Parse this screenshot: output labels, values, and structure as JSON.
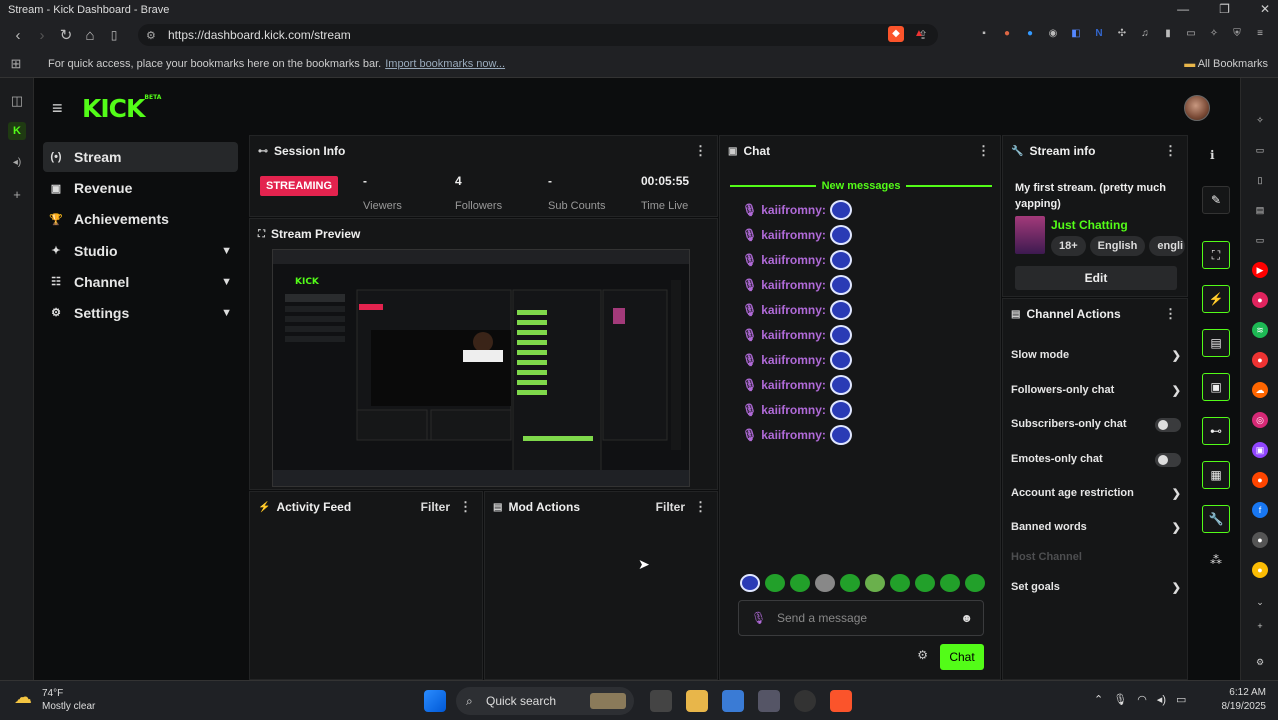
{
  "window": {
    "title": "Stream - Kick Dashboard - Brave",
    "controls": [
      "—",
      "❐",
      "✕"
    ]
  },
  "browser": {
    "url": "https://dashboard.kick.com/stream",
    "bookmarks_prompt": "For quick access, place your bookmarks here on the bookmarks bar.",
    "import_link": "Import bookmarks now...",
    "all_bookmarks": "All Bookmarks"
  },
  "brand": {
    "logo": "KICK",
    "beta": "BETA",
    "accent": "#53fc18"
  },
  "sidebar": {
    "items": [
      {
        "label": "Stream",
        "icon": "(•)"
      },
      {
        "label": "Revenue",
        "icon": "▣"
      },
      {
        "label": "Achievements",
        "icon": "🏆"
      },
      {
        "label": "Studio",
        "icon": "✦"
      },
      {
        "label": "Channel",
        "icon": "☷"
      },
      {
        "label": "Settings",
        "icon": "⚙"
      }
    ]
  },
  "session": {
    "title": "Session Info",
    "status": "STREAMING",
    "stats": [
      {
        "value": "-",
        "label": "Viewers"
      },
      {
        "value": "4",
        "label": "Followers"
      },
      {
        "value": "-",
        "label": "Sub Counts"
      },
      {
        "value": "00:05:55",
        "label": "Time Live"
      }
    ]
  },
  "preview": {
    "title": "Stream Preview"
  },
  "activity": {
    "title": "Activity Feed",
    "filter": "Filter"
  },
  "mod": {
    "title": "Mod Actions",
    "filter": "Filter"
  },
  "chat": {
    "title": "Chat",
    "new_messages": "New messages",
    "messages": [
      {
        "user": "kaiifromny:"
      },
      {
        "user": "kaiifromny:"
      },
      {
        "user": "kaiifromny:"
      },
      {
        "user": "kaiifromny:"
      },
      {
        "user": "kaiifromny:"
      },
      {
        "user": "kaiifromny:"
      },
      {
        "user": "kaiifromny:"
      },
      {
        "user": "kaiifromny:"
      },
      {
        "user": "kaiifromny:"
      },
      {
        "user": "kaiifromny:"
      }
    ],
    "placeholder": "Send a message",
    "send_label": "Chat"
  },
  "stream_info": {
    "title": "Stream info",
    "stream_title": "My first stream. (pretty much yapping)",
    "category": "Just Chatting",
    "tags": [
      "18+",
      "English",
      "engli"
    ],
    "edit_label": "Edit"
  },
  "channel_actions": {
    "title": "Channel Actions",
    "items": [
      {
        "label": "Slow mode",
        "control": "chevron"
      },
      {
        "label": "Followers-only chat",
        "control": "chevron"
      },
      {
        "label": "Subscribers-only chat",
        "control": "toggle"
      },
      {
        "label": "Emotes-only chat",
        "control": "toggle"
      },
      {
        "label": "Account age restriction",
        "control": "chevron"
      },
      {
        "label": "Banned words",
        "control": "chevron"
      },
      {
        "label": "Host Channel",
        "control": "none"
      },
      {
        "label": "Set goals",
        "control": "chevron"
      }
    ]
  },
  "taskbar": {
    "weather_temp": "74°F",
    "weather_desc": "Mostly clear",
    "search_label": "Quick search",
    "time": "6:12 AM",
    "date": "8/19/2025"
  }
}
